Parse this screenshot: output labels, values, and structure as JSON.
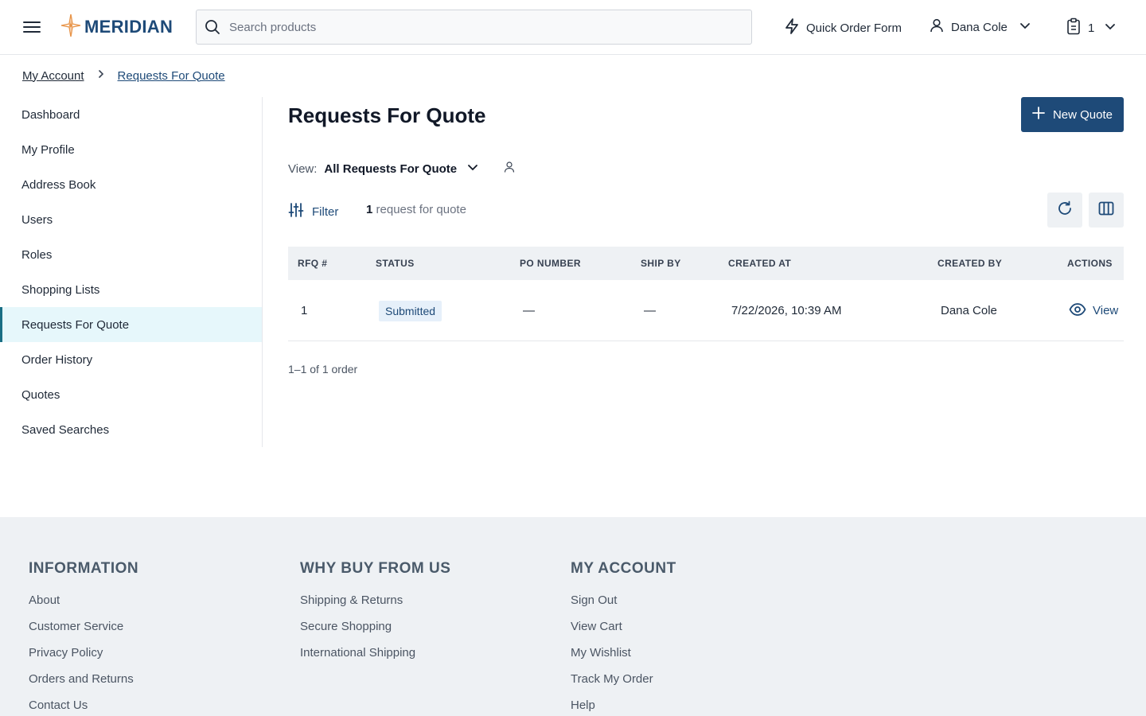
{
  "header": {
    "brand": "MERIDIAN",
    "search_placeholder": "Search products",
    "quick_order_label": "Quick Order Form",
    "user_name": "Dana Cole",
    "cart_count": "1"
  },
  "breadcrumb": {
    "items": [
      "My Account",
      "Requests For Quote"
    ]
  },
  "sidebar": {
    "items": [
      {
        "label": "Dashboard"
      },
      {
        "label": "My Profile"
      },
      {
        "label": "Address Book"
      },
      {
        "label": "Users"
      },
      {
        "label": "Roles"
      },
      {
        "label": "Shopping Lists"
      },
      {
        "label": "Requests For Quote",
        "active": true
      },
      {
        "label": "Order History"
      },
      {
        "label": "Quotes"
      },
      {
        "label": "Saved Searches"
      }
    ]
  },
  "main": {
    "title": "Requests For Quote",
    "new_quote_label": "New Quote",
    "view_label": "View:",
    "view_value": "All Requests For Quote",
    "filter_label": "Filter",
    "count_number": "1",
    "count_text": "request for quote",
    "table": {
      "headers": [
        "RFQ #",
        "STATUS",
        "PO NUMBER",
        "SHIP BY",
        "CREATED AT",
        "CREATED BY",
        "ACTIONS"
      ],
      "rows": [
        {
          "rfq": "1",
          "status": "Submitted",
          "po_number": "—",
          "ship_by": "—",
          "created_at": "7/22/2026, 10:39 AM",
          "created_by": "Dana Cole",
          "action": "View"
        }
      ]
    },
    "pager_text": "1–1 of 1 order"
  },
  "footer": {
    "columns": [
      {
        "heading": "INFORMATION",
        "links": [
          "About",
          "Customer Service",
          "Privacy Policy",
          "Orders and Returns",
          "Contact Us"
        ]
      },
      {
        "heading": "WHY BUY FROM US",
        "links": [
          "Shipping & Returns",
          "Secure Shopping",
          "International Shipping"
        ]
      },
      {
        "heading": "MY ACCOUNT",
        "links": [
          "Sign Out",
          "View Cart",
          "My Wishlist",
          "Track My Order",
          "Help"
        ]
      }
    ]
  },
  "colors": {
    "brand": "#1e4a78",
    "active_bg": "#e6f7fb",
    "footer_bg": "#eef1f4"
  }
}
